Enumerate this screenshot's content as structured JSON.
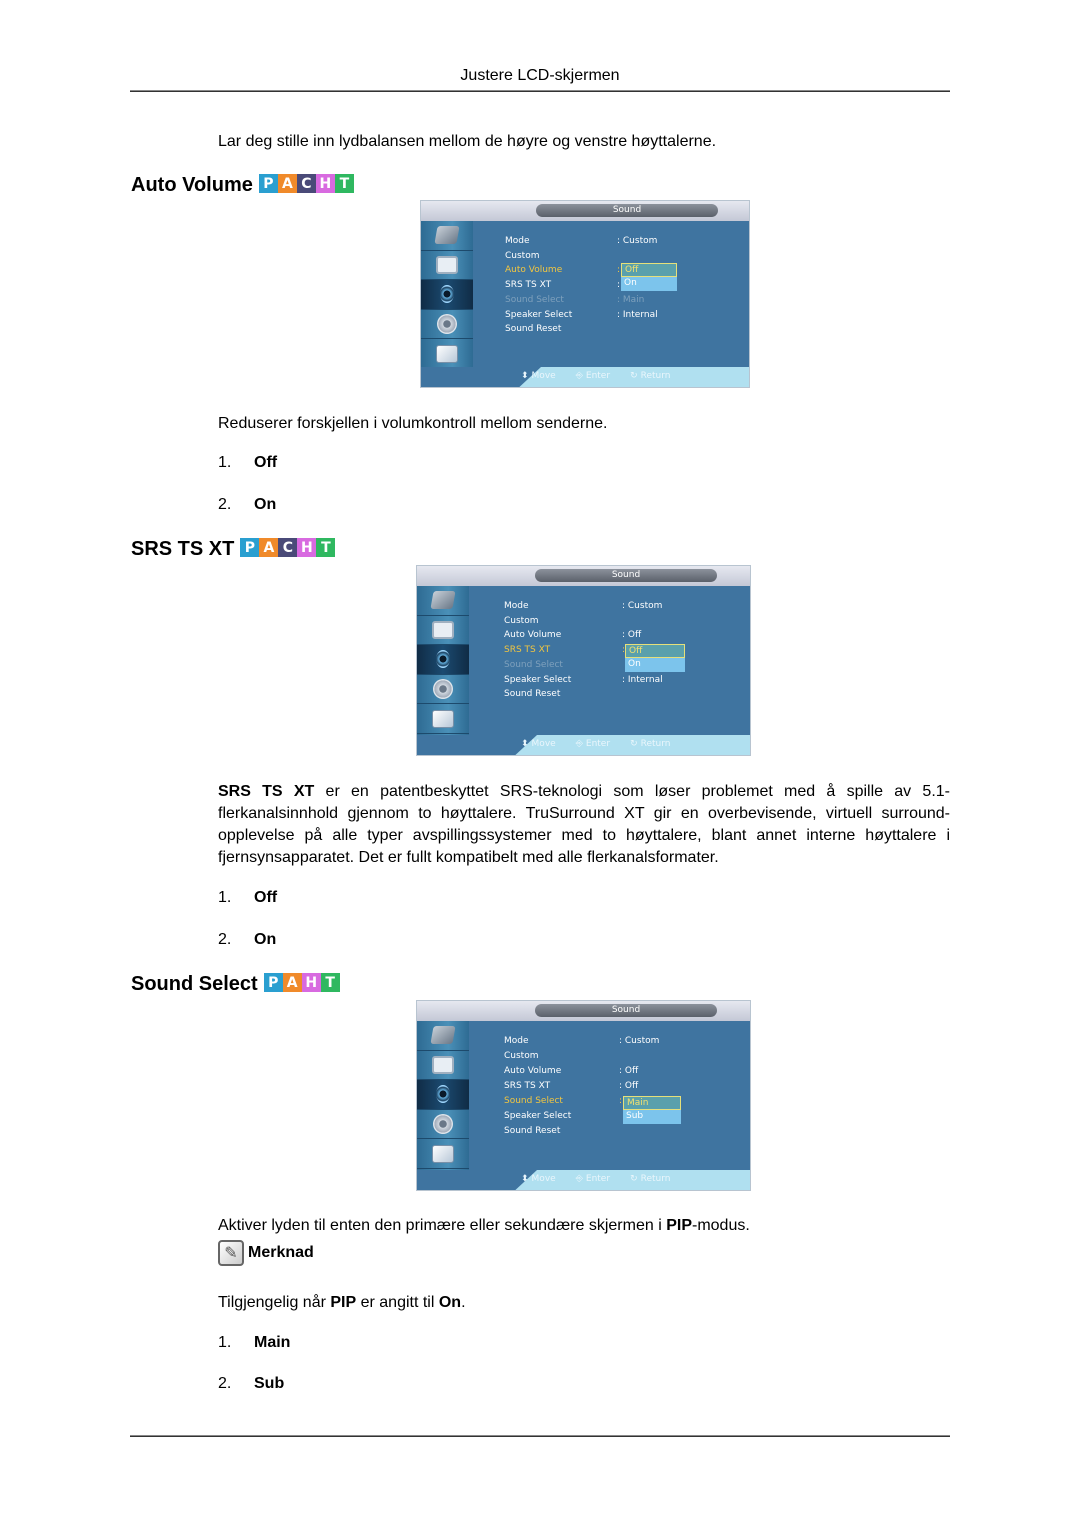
{
  "header": {
    "title": "Justere LCD-skjermen"
  },
  "intro": "Lar deg stille inn lydbalansen mellom de høyre og venstre høyttalerne.",
  "sections": [
    {
      "title": "Auto Volume",
      "badges": [
        "P",
        "A",
        "C",
        "H",
        "T"
      ],
      "osd": {
        "title": "Sound",
        "sidebar": [
          "input-icon",
          "picture-icon",
          "sound-icon",
          "setup-icon",
          "multi-control-icon"
        ],
        "rows": [
          {
            "label": "Mode",
            "value": ": Custom"
          },
          {
            "label": "Custom",
            "value": ""
          },
          {
            "label": "Auto Volume",
            "value": ":"
          },
          {
            "label": "SRS TS XT",
            "value": ":"
          },
          {
            "label": "Sound Select",
            "value": ": Main"
          },
          {
            "label": "Speaker Select",
            "value": ": Internal"
          },
          {
            "label": "Sound Reset",
            "value": ""
          }
        ],
        "dropdown": [
          "Off",
          "On"
        ],
        "hints": [
          "Move",
          "Enter",
          "Return"
        ]
      },
      "description": "Reduserer forskjellen i volumkontroll mellom senderne.",
      "options": [
        {
          "num": "1.",
          "label": "Off"
        },
        {
          "num": "2.",
          "label": "On"
        }
      ]
    },
    {
      "title": "SRS TS XT",
      "badges": [
        "P",
        "A",
        "C",
        "H",
        "T"
      ],
      "osd": {
        "title": "Sound",
        "rows": [
          {
            "label": "Mode",
            "value": ": Custom"
          },
          {
            "label": "Custom",
            "value": ""
          },
          {
            "label": "Auto Volume",
            "value": ": Off"
          },
          {
            "label": "SRS TS XT",
            "value": ":"
          },
          {
            "label": "Sound Select",
            "value": ""
          },
          {
            "label": "Speaker Select",
            "value": ": Internal"
          },
          {
            "label": "Sound Reset",
            "value": ""
          }
        ],
        "dropdown": [
          "Off",
          "On"
        ],
        "hints": [
          "Move",
          "Enter",
          "Return"
        ]
      },
      "description_bold": "SRS TS XT",
      "description": " er en patentbeskyttet SRS-teknologi som løser problemet med å spille av 5.1-flerkanalsinnhold gjennom to høyttalere. TruSurround XT gir en overbevisende, virtuell surround-opplevelse på alle typer avspillingssystemer med to høyttalere, blant annet interne høyttalere i fjernsynsapparatet. Det er fullt kompatibelt med alle flerkanalsformater.",
      "options": [
        {
          "num": "1.",
          "label": "Off"
        },
        {
          "num": "2.",
          "label": "On"
        }
      ]
    },
    {
      "title": "Sound Select",
      "badges": [
        "P",
        "A",
        "H",
        "T"
      ],
      "osd": {
        "title": "Sound",
        "rows": [
          {
            "label": "Mode",
            "value": ": Custom"
          },
          {
            "label": "Custom",
            "value": ""
          },
          {
            "label": "Auto Volume",
            "value": ": Off"
          },
          {
            "label": "SRS TS XT",
            "value": ": Off"
          },
          {
            "label": "Sound Select",
            "value": ":"
          },
          {
            "label": "Speaker Select",
            "value": ""
          },
          {
            "label": "Sound Reset",
            "value": ""
          }
        ],
        "dropdown": [
          "Main",
          "Sub"
        ],
        "hints": [
          "Move",
          "Enter",
          "Return"
        ]
      },
      "description_pre": "Aktiver lyden til enten den primære eller sekundære skjermen i ",
      "description_bold": "PIP",
      "description_post": "-modus.",
      "note": {
        "label": "Merknad",
        "text_pre": "Tilgjengelig når ",
        "text_bold1": "PIP",
        "text_mid": " er angitt til ",
        "text_bold2": "On",
        "text_post": "."
      },
      "options": [
        {
          "num": "1.",
          "label": "Main"
        },
        {
          "num": "2.",
          "label": "Sub"
        }
      ]
    }
  ]
}
